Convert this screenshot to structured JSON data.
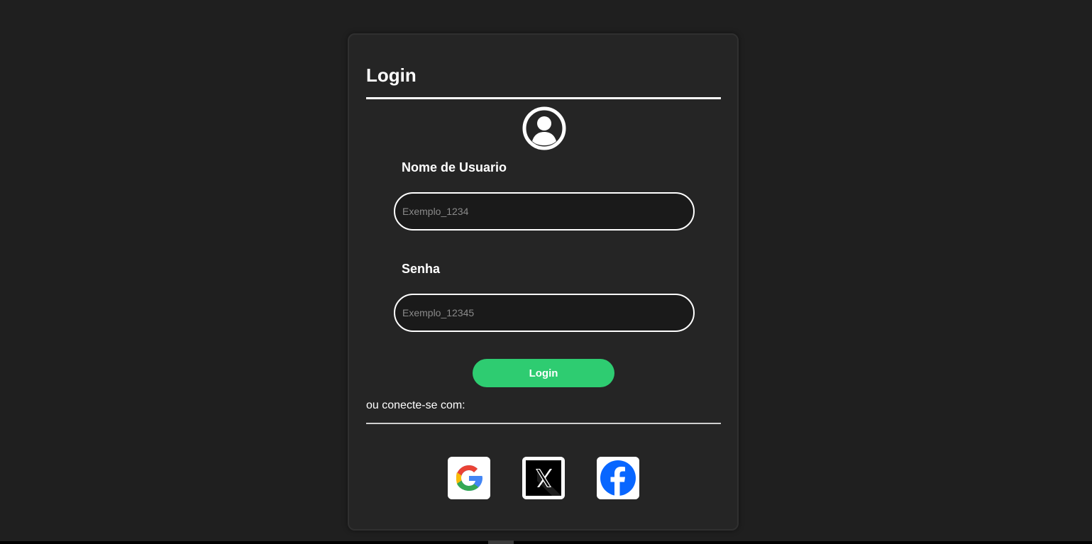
{
  "login_card": {
    "title": "Login",
    "avatar_icon": "user-circle-icon",
    "username": {
      "label": "Nome de Usuario",
      "placeholder": "Exemplo_1234",
      "value": ""
    },
    "password": {
      "label": "Senha",
      "placeholder": "Exemplo_12345",
      "value": ""
    },
    "login_button": "Login",
    "alternative_text": "ou conecte-se com:",
    "social_logins": [
      {
        "name": "Google",
        "icon": "google-icon"
      },
      {
        "name": "X",
        "icon": "x-icon"
      },
      {
        "name": "Facebook",
        "icon": "facebook-icon"
      }
    ]
  },
  "colors": {
    "page_background": "#1f1f1f",
    "card_background": "#252525",
    "accent": "#2ecc71",
    "text": "#ffffff",
    "facebook_blue": "#0866ff"
  }
}
